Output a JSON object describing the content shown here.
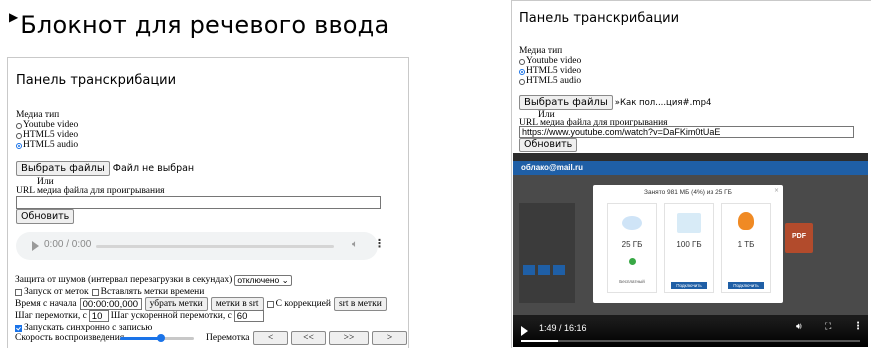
{
  "left": {
    "page_title": "Блокнот для речевого ввода",
    "panel_title": "Панель транскрибации",
    "media_type_label": "Медиа тип",
    "media_options": [
      {
        "label": "Youtube video",
        "selected": false
      },
      {
        "label": "HTML5 video",
        "selected": false
      },
      {
        "label": "HTML5 audio",
        "selected": true
      }
    ],
    "choose_files_label": "Выбрать файлы",
    "no_file_text": "Файл не выбран",
    "or_text": "Или",
    "url_label": "URL медиа файла для проигрывания",
    "url_value": "",
    "refresh_label": "Обновить",
    "audio_time": "0:00 / 0:00",
    "noise_label": "Защита от шумов (интервал перезагрузки в секундах)",
    "noise_value": "отключено",
    "timestamps_start_label": "Запуск от меток",
    "insert_timestamps_label": "Вставлять метки времени",
    "time_from_start_label": "Время с начала",
    "time_value": "00:00:00,000",
    "remove_marks_label": "убрать метки",
    "marks_srt_label": "метки в srt",
    "with_correction_label": "С коррекцией",
    "srt_to_marks_label": "srt в метки",
    "rewind_step_label": "Шаг перемотки, с",
    "rewind_step_value": "10",
    "fast_rewind_label": "Шаг ускоренной перемотки, с",
    "fast_rewind_value": "60",
    "sync_record_label": "Запускать синхронно с записью",
    "speed_label": "Скорость воспроизведения",
    "rewind_label": "Перемотка",
    "rewind_buttons": [
      "<",
      "<<",
      ">>",
      ">"
    ],
    "speed_level": 0.55
  },
  "right": {
    "panel_title": "Панель транскрибации",
    "media_type_label": "Медиа тип",
    "media_options": [
      {
        "label": "Youtube video",
        "selected": false
      },
      {
        "label": "HTML5 video",
        "selected": true
      },
      {
        "label": "HTML5 audio",
        "selected": false
      }
    ],
    "choose_files_label": "Выбрать файлы",
    "file_name": "»Как пол....ция#.mp4",
    "or_text": "Или",
    "url_label": "URL медиа файла для проигрывания",
    "url_value": "https://www.youtube.com/watch?v=DaFKim0tUaE",
    "refresh_label": "Обновить",
    "video": {
      "site_logo": "облако@mail.ru",
      "dialog_title": "Занято 981 МБ (4%) из 25 ГБ",
      "plans": [
        {
          "size": "25 ГБ",
          "button": "Бесплатный"
        },
        {
          "size": "100 ГБ",
          "button": "Подключить"
        },
        {
          "size": "1 ТБ",
          "button": "Подключить"
        }
      ],
      "side_badge": "PDF",
      "time": "1:49 / 16:16",
      "progress": 0.11
    }
  }
}
